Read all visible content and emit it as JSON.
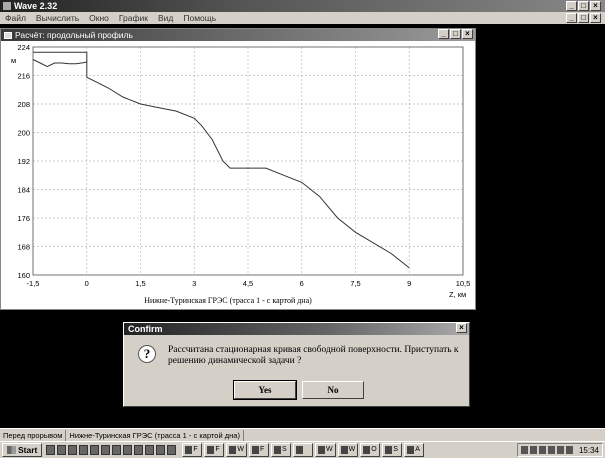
{
  "app": {
    "title": "Wave 2.32",
    "menu": [
      "Файл",
      "Вычислить",
      "Окно",
      "График",
      "Вид",
      "Помощь"
    ]
  },
  "child_window": {
    "title": "Расчёт: продольный профиль"
  },
  "window_buttons": {
    "minimize": "_",
    "restore": "□",
    "close": "×"
  },
  "chart_data": {
    "type": "line",
    "title": "",
    "xlabel": "Нижне-Туринская ГРЭС (трасса 1 - с картой дна)",
    "xunit": "Z, км",
    "ylabel": "м",
    "xlim": [
      -1.5,
      10.5
    ],
    "ylim": [
      160,
      224
    ],
    "xticks": [
      -1.5,
      0,
      1.5,
      3,
      4.5,
      6,
      7.5,
      9,
      10.5
    ],
    "xtick_labels": [
      "-1,5",
      "0",
      "1,5",
      "3",
      "4,5",
      "6",
      "7,5",
      "9",
      "10,5"
    ],
    "yticks": [
      160,
      168,
      176,
      184,
      192,
      200,
      208,
      216,
      224
    ],
    "grid": true,
    "series": [
      {
        "x": [
          -1.5,
          -1.3,
          -1.1,
          -0.9,
          -0.7,
          -0.5,
          -0.3,
          -0.1,
          0,
          0,
          0.3,
          0.6,
          1.0,
          1.5,
          2.0,
          2.5,
          3.0,
          3.2,
          3.5,
          3.8,
          4.0,
          4.5,
          5.0,
          5.5,
          6.0,
          6.5,
          7.0,
          7.5,
          8.0,
          8.5,
          9.0
        ],
        "y": [
          220.5,
          219.5,
          218.5,
          219.5,
          219.5,
          219.3,
          219.3,
          219.6,
          219.8,
          215.5,
          214,
          212.5,
          210,
          208,
          207,
          206,
          204,
          202,
          198,
          192,
          190,
          190,
          190,
          188,
          186,
          182,
          176,
          172,
          169,
          166,
          162
        ]
      },
      {
        "x": [
          -1.5,
          0,
          0
        ],
        "y": [
          222.5,
          222.5,
          219.8
        ]
      }
    ]
  },
  "dialog": {
    "title": "Confirm",
    "message": "Рассчитана стационарная кривая свободной поверхности. Приступать к решению динамической задачи ?",
    "icon": "question-icon",
    "yes_label": "Yes",
    "no_label": "No"
  },
  "statusbar": {
    "left": "Перед прорывом",
    "right": "Нижне-Туринская ГРЭС (трасса 1 - с картой дна)"
  },
  "taskbar": {
    "start_label": "Start",
    "tasks": [
      "F",
      "F",
      "W",
      "F",
      "S",
      "",
      "W",
      "W",
      "O",
      "S",
      "A"
    ],
    "clock": "15:34"
  }
}
